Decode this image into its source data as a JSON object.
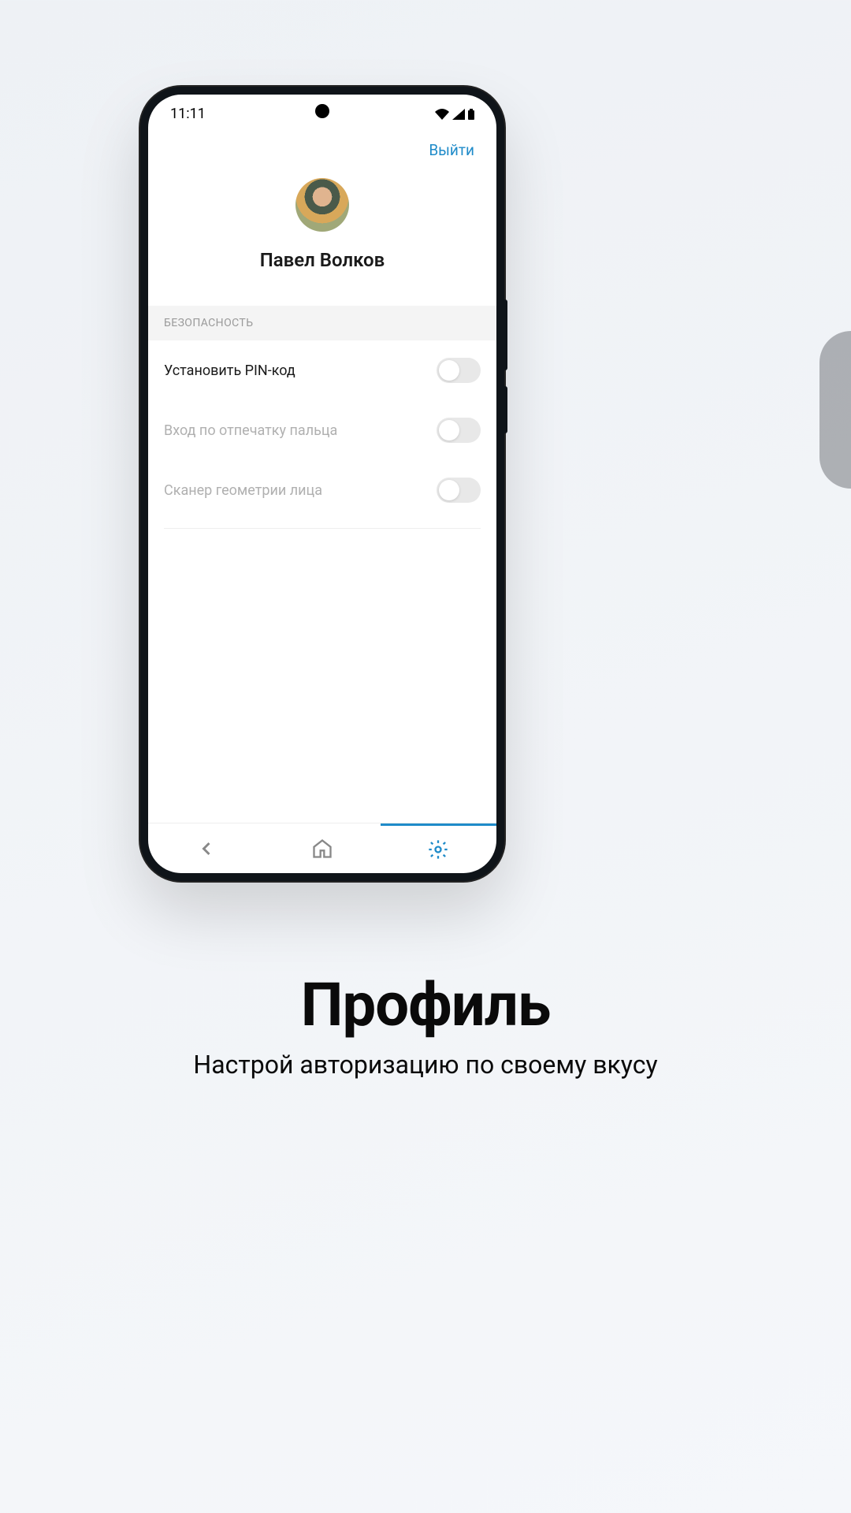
{
  "status": {
    "time": "11:11"
  },
  "header": {
    "logout": "Выйти"
  },
  "profile": {
    "name": "Павел Волков"
  },
  "section": {
    "title": "БЕЗОПАСНОСТЬ"
  },
  "settings": [
    {
      "label": "Установить PIN-код",
      "enabled": true,
      "value": false
    },
    {
      "label": "Вход по отпечатку пальца",
      "enabled": false,
      "value": false
    },
    {
      "label": "Сканер геометрии лица",
      "enabled": false,
      "value": false
    }
  ],
  "nav": {
    "active": "settings",
    "icons": [
      "back",
      "home",
      "settings"
    ]
  },
  "marketing": {
    "title": "Профиль",
    "subtitle": "Настрой авторизацию по своему вкусу"
  },
  "colors": {
    "accent": "#1f8bc9"
  }
}
